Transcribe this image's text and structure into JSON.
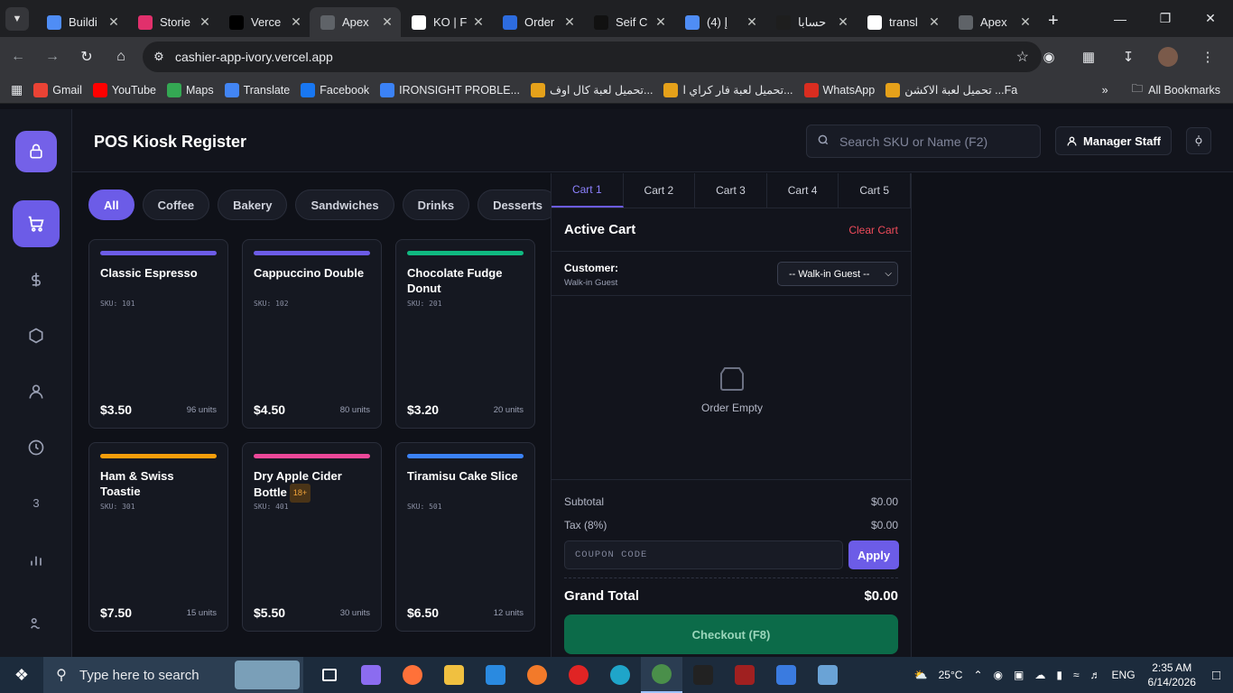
{
  "browser": {
    "tabs": [
      {
        "title": "Buildi",
        "color": "#4f8df5"
      },
      {
        "title": "Storie",
        "color": "#e1306c"
      },
      {
        "title": "Verce",
        "color": "#000000"
      },
      {
        "title": "Apex",
        "color": "#5f6368"
      },
      {
        "title": "KO | F",
        "color": "#ffffff"
      },
      {
        "title": "Order",
        "color": "#2d6cdf"
      },
      {
        "title": "Seif C",
        "color": "#111111"
      },
      {
        "title": "(4) ‫إ",
        "color": "#4f8df5"
      },
      {
        "title": "حسابا",
        "color": "#1e1e1e"
      },
      {
        "title": "transl",
        "color": "#ffffff"
      },
      {
        "title": "Apex",
        "color": "#5f6368"
      }
    ],
    "active_tab": 3,
    "url": "cashier-app-ivory.vercel.app",
    "bookmarks": [
      {
        "label": "Gmail",
        "color": "#ea4335"
      },
      {
        "label": "YouTube",
        "color": "#ff0000"
      },
      {
        "label": "Maps",
        "color": "#34a853"
      },
      {
        "label": "Translate",
        "color": "#4285f4"
      },
      {
        "label": "Facebook",
        "color": "#1877f2"
      },
      {
        "label": "IRONSIGHT PROBLE...",
        "color": "#3b82f6"
      },
      {
        "label": "تحميل لعبة كال اوف...",
        "color": "#e5a11a"
      },
      {
        "label": "تحميل لعبة فار كراي ا...",
        "color": "#e5a11a"
      },
      {
        "label": "WhatsApp",
        "color": "#d92d20"
      },
      {
        "label": "تحميل لعبة الاكشن ...Fa",
        "color": "#e5a11a"
      }
    ],
    "all_bookmarks": "All Bookmarks"
  },
  "app": {
    "title": "POS Kiosk Register",
    "search_placeholder": "Search SKU or Name (F2)",
    "staff_label": "Manager Staff",
    "rail_badge": "3",
    "categories": [
      "All",
      "Coffee",
      "Bakery",
      "Sandwiches",
      "Drinks",
      "Desserts"
    ],
    "active_category": "All",
    "products": [
      {
        "name": "Classic Espresso",
        "sku": "SKU: 101",
        "price": "$3.50",
        "units": "96 units",
        "color": "#6c5ce7",
        "badge": ""
      },
      {
        "name": "Cappuccino Double",
        "sku": "SKU: 102",
        "price": "$4.50",
        "units": "80 units",
        "color": "#6c5ce7",
        "badge": ""
      },
      {
        "name": "Chocolate Fudge Donut",
        "sku": "SKU: 201",
        "price": "$3.20",
        "units": "20 units",
        "color": "#10b981",
        "badge": ""
      },
      {
        "name": "Ham & Swiss Toastie",
        "sku": "SKU: 301",
        "price": "$7.50",
        "units": "15 units",
        "color": "#f59e0b",
        "badge": ""
      },
      {
        "name": "Dry Apple Cider Bottle",
        "sku": "SKU: 401",
        "price": "$5.50",
        "units": "30 units",
        "color": "#ec4899",
        "badge": "18+"
      },
      {
        "name": "Tiramisu Cake Slice",
        "sku": "SKU: 501",
        "price": "$6.50",
        "units": "12 units",
        "color": "#3b82f6",
        "badge": ""
      }
    ],
    "cart": {
      "tabs": [
        "Cart 1",
        "Cart 2",
        "Cart 3",
        "Cart 4",
        "Cart 5"
      ],
      "active_tab": "Cart 1",
      "heading": "Active Cart",
      "clear_label": "Clear Cart",
      "customer_label": "Customer:",
      "customer_value": "Walk-in Guest",
      "customer_select": "-- Walk-in Guest --",
      "empty_text": "Order Empty",
      "subtotal_label": "Subtotal",
      "subtotal_value": "$0.00",
      "tax_label": "Tax (8%)",
      "tax_value": "$0.00",
      "coupon_placeholder": "COUPON CODE",
      "apply_label": "Apply",
      "grand_label": "Grand Total",
      "grand_value": "$0.00",
      "checkout_label": "Checkout (F8)"
    }
  },
  "taskbar": {
    "search_placeholder": "Type here to search",
    "temperature": "25°C",
    "language": "ENG",
    "time": "2:35 AM",
    "date": "6/14/2026"
  }
}
